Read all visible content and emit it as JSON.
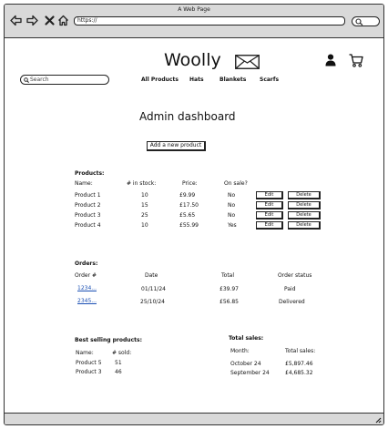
{
  "window": {
    "title": "A Web Page",
    "url": "https://"
  },
  "header": {
    "brand": "Woolly",
    "search_placeholder": "Search",
    "nav": [
      "All Products",
      "Hats",
      "Blankets",
      "Scarfs"
    ]
  },
  "page": {
    "title": "Admin dashboard",
    "add_button": "Add a new product"
  },
  "products": {
    "title": "Products:",
    "headers": [
      "Name:",
      "# in stock:",
      "Price:",
      "On sale?"
    ],
    "rows": [
      {
        "name": "Product 1",
        "stock": "10",
        "price": "£9.99",
        "sale": "No"
      },
      {
        "name": "Product 2",
        "stock": "15",
        "price": "£17.50",
        "sale": "No"
      },
      {
        "name": "Product 3",
        "stock": "25",
        "price": "£5.65",
        "sale": "No"
      },
      {
        "name": "Product 4",
        "stock": "10",
        "price": "£55.99",
        "sale": "Yes"
      }
    ],
    "edit_label": "Edit",
    "delete_label": "Delete"
  },
  "orders": {
    "title": "Orders:",
    "headers": [
      "Order #",
      "Date",
      "Total",
      "Order status"
    ],
    "rows": [
      {
        "id": "1234...",
        "date": "01/11/24",
        "total": "£39.97",
        "status": "Paid"
      },
      {
        "id": "2345...",
        "date": "25/10/24",
        "total": "£56.85",
        "status": "Delivered"
      }
    ]
  },
  "best_selling": {
    "title": "Best selling products:",
    "headers": [
      "Name:",
      "# sold:"
    ],
    "rows": [
      {
        "name": "Product 5",
        "sold": "51"
      },
      {
        "name": "Product 3",
        "sold": "46"
      }
    ]
  },
  "total_sales": {
    "title": "Total sales:",
    "headers": [
      "Month:",
      "Total sales:"
    ],
    "rows": [
      {
        "month": "October 24",
        "total": "£5,897.46"
      },
      {
        "month": "September 24",
        "total": "£4,685.32"
      }
    ]
  }
}
